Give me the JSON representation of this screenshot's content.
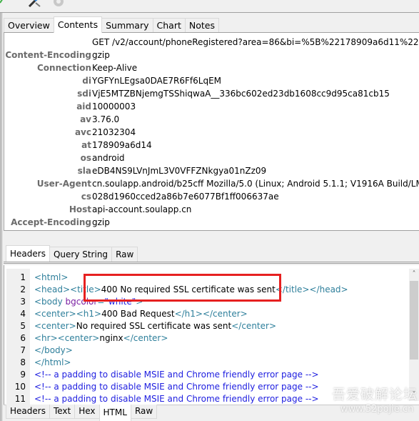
{
  "toolbar": {
    "icons": [
      "check-icon",
      "tools-icon",
      "gear-icon"
    ]
  },
  "top_tabs": [
    {
      "label": "Overview",
      "active": false
    },
    {
      "label": "Contents",
      "active": true
    },
    {
      "label": "Summary",
      "active": false
    },
    {
      "label": "Chart",
      "active": false
    },
    {
      "label": "Notes",
      "active": false
    }
  ],
  "request_headers": {
    "request_line": "GET /v2/account/phoneRegistered?area=86&bi=%5B%22178909a6d11%22%...",
    "rows": [
      {
        "key": "Content-Encoding",
        "value": "gzip"
      },
      {
        "key": "Connection",
        "value": "Keep-Alive"
      },
      {
        "key": "di",
        "value": "YGFYnLEgsa0DAE7R6Ff6LqEM"
      },
      {
        "key": "sdi",
        "value": "VjE5MTZBNjemgTSShiqwaA__336bc602ed23db1608cc9d95ca81cb15"
      },
      {
        "key": "aid",
        "value": "10000003"
      },
      {
        "key": "av",
        "value": "3.76.0"
      },
      {
        "key": "avc",
        "value": "21032304"
      },
      {
        "key": "at",
        "value": "178909a6d14"
      },
      {
        "key": "os",
        "value": "android"
      },
      {
        "key": "sla",
        "value": "eDB4NS9LVnJmL3V0VFFZNkgya01nZz09"
      },
      {
        "key": "User-Agent",
        "value": "cn.soulapp.android/b25cff Mozilla/5.0 (Linux; Android 5.1.1; V1916A Build/LM..."
      },
      {
        "key": "cs",
        "value": "028d1960cced2a86b7e6077Bf1ff006637ae"
      },
      {
        "key": "Host",
        "value": "api-account.soulapp.cn"
      },
      {
        "key": "Accept-Encoding",
        "value": "gzip"
      }
    ]
  },
  "request_tabs": [
    {
      "label": "Headers",
      "active": true
    },
    {
      "label": "Query String",
      "active": false
    },
    {
      "label": "Raw",
      "active": false
    }
  ],
  "response_code": {
    "lines": [
      {
        "num": "1",
        "parts": [
          {
            "c": "tag",
            "t": "<html>"
          }
        ]
      },
      {
        "num": "2",
        "parts": [
          {
            "c": "tag",
            "t": "<head><title>"
          },
          {
            "c": "txt",
            "t": "400 No required SSL certificate was sent"
          },
          {
            "c": "tag",
            "t": "</title></head>"
          }
        ]
      },
      {
        "num": "3",
        "parts": [
          {
            "c": "tag",
            "t": "<body "
          },
          {
            "c": "attr",
            "t": "bgcolor"
          },
          {
            "c": "tag",
            "t": "="
          },
          {
            "c": "val",
            "t": "\"white\""
          },
          {
            "c": "tag",
            "t": ">"
          }
        ]
      },
      {
        "num": "4",
        "parts": [
          {
            "c": "tag",
            "t": "<center><h1>"
          },
          {
            "c": "txt",
            "t": "400 Bad Request"
          },
          {
            "c": "tag",
            "t": "</h1></center>"
          }
        ]
      },
      {
        "num": "5",
        "parts": [
          {
            "c": "tag",
            "t": "<center>"
          },
          {
            "c": "txt",
            "t": "No required SSL certificate was sent"
          },
          {
            "c": "tag",
            "t": "</center>"
          }
        ]
      },
      {
        "num": "6",
        "parts": [
          {
            "c": "tag",
            "t": "<hr><center>"
          },
          {
            "c": "txt",
            "t": "nginx"
          },
          {
            "c": "tag",
            "t": "</center>"
          }
        ]
      },
      {
        "num": "7",
        "parts": [
          {
            "c": "tag",
            "t": "</body>"
          }
        ]
      },
      {
        "num": "8",
        "parts": [
          {
            "c": "tag",
            "t": "</html>"
          }
        ]
      },
      {
        "num": "9",
        "parts": [
          {
            "c": "cmt",
            "t": "<!-- a padding to disable MSIE and Chrome friendly error page -->"
          }
        ]
      },
      {
        "num": "10",
        "parts": [
          {
            "c": "cmt",
            "t": "<!-- a padding to disable MSIE and Chrome friendly error page -->"
          }
        ]
      },
      {
        "num": "11",
        "parts": [
          {
            "c": "cmt",
            "t": "<!-- a padding to disable MSIE and Chrome friendly error page -->"
          }
        ]
      }
    ],
    "highlighted_text": "400 No required SSL certificate was sent",
    "highlight_color": "#e62020"
  },
  "response_tabs": [
    {
      "label": "Headers",
      "active": false
    },
    {
      "label": "Text",
      "active": false
    },
    {
      "label": "Hex",
      "active": false
    },
    {
      "label": "HTML",
      "active": true
    },
    {
      "label": "Raw",
      "active": false
    }
  ],
  "scrollbar": {
    "up_glyph": "˄",
    "down_glyph": "˅"
  },
  "watermark": {
    "title": "吾爱破解论坛",
    "url": "www.52pojie.cn"
  }
}
